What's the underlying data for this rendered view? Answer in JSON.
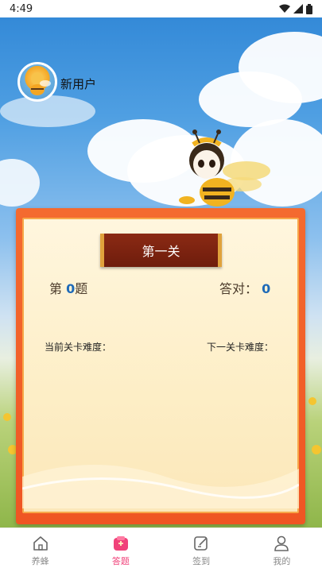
{
  "status_bar": {
    "time": "4:49"
  },
  "profile": {
    "name": "新用户"
  },
  "card": {
    "level_title": "第一关",
    "question_prefix": "第",
    "question_number": "0",
    "question_suffix": "题",
    "correct_label": "答对：",
    "correct_count": "0",
    "current_difficulty_label": "当前关卡难度：",
    "next_difficulty_label": "下一关卡难度："
  },
  "nav": {
    "items": [
      {
        "label": "养蜂",
        "icon": "home-icon"
      },
      {
        "label": "答题",
        "icon": "quiz-icon"
      },
      {
        "label": "签到",
        "icon": "checkin-icon"
      },
      {
        "label": "我的",
        "icon": "profile-icon"
      }
    ],
    "active_index": 1,
    "active_color": "#f0427a"
  }
}
